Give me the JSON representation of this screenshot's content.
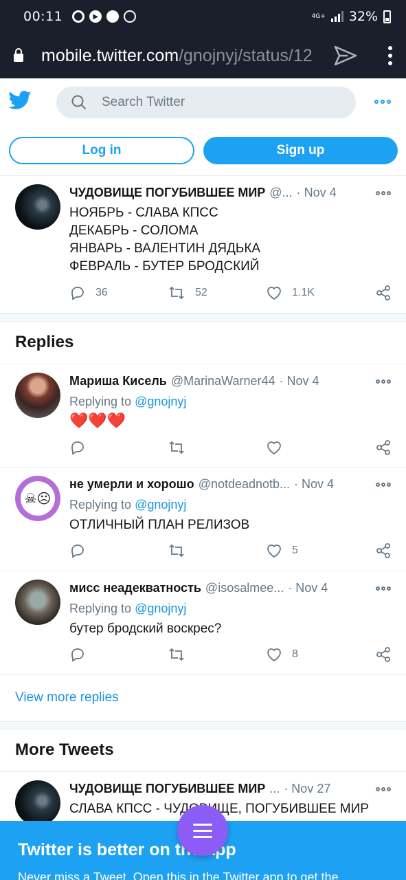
{
  "status_bar": {
    "time": "00:11",
    "network": "4G+",
    "battery": "32%"
  },
  "browser": {
    "url_host": "mobile.twitter.com",
    "url_path": "/gnojnyj/status/12"
  },
  "header": {
    "search_placeholder": "Search Twitter",
    "login_label": "Log in",
    "signup_label": "Sign up"
  },
  "main_tweet": {
    "name": "ЧУДОВИЩЕ ПОГУБИВШЕЕ МИР",
    "handle": "@...",
    "date": "· Nov 4",
    "lines": [
      "НОЯБРЬ - СЛАВА КПСС",
      "ДЕКАБРЬ - СОЛОМА",
      "ЯНВАРЬ - ВАЛЕНТИН ДЯДЬКА",
      "ФЕВРАЛЬ - БУТЕР БРОДСКИЙ"
    ],
    "replies": "36",
    "retweets": "52",
    "likes": "1.1K"
  },
  "replies_section": {
    "title": "Replies",
    "replying_to_label": "Replying to",
    "items": [
      {
        "name": "Мариша Кисель",
        "handle": "@MarinaWarner44",
        "date": "· Nov 4",
        "mention": "@gnojnyj",
        "text": "❤️❤️❤️",
        "likes": ""
      },
      {
        "name": "не умерли и хорошо",
        "handle": "@notdeadnotb...",
        "date": "· Nov 4",
        "mention": "@gnojnyj",
        "text": "ОТЛИЧНЫЙ ПЛАН РЕЛИЗОВ",
        "likes": "5"
      },
      {
        "name": "мисс неадекватность",
        "handle": "@isosalmee...",
        "date": "· Nov 4",
        "mention": "@gnojnyj",
        "text": "бутер бродский воскрес?",
        "likes": "8"
      }
    ],
    "view_more": "View more replies"
  },
  "more_tweets": {
    "title": "More Tweets",
    "item": {
      "name": "ЧУДОВИЩЕ ПОГУБИВШЕЕ МИР",
      "handle": "...",
      "date": "· Nov 27",
      "text": "СЛАВА КПСС - ЧУДОВИЩЕ, ПОГУБИВШЕЕ МИР"
    }
  },
  "banner": {
    "title": "Twitter is better on the app",
    "subtitle": "Never miss a Tweet. Open this in the Twitter app to get the"
  },
  "colors": {
    "brand": "#1da1f2",
    "fab": "#8b5cf6",
    "dark_bar": "#1b1e2b"
  }
}
